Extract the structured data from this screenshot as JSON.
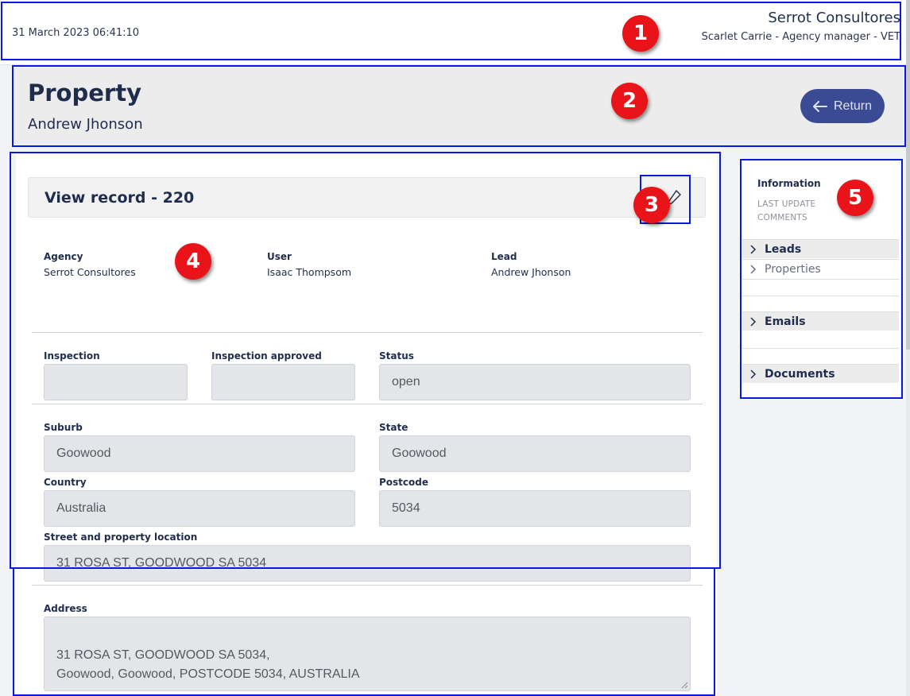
{
  "topbar": {
    "datetime": "31 March 2023 06:41:10",
    "company": "Serrot Consultores",
    "user_line": "Scarlet Carrie - Agency manager - VET"
  },
  "header": {
    "title": "Property",
    "subtitle": "Andrew Jhonson",
    "return_label": "Return"
  },
  "record": {
    "title": "View record - 220",
    "info": [
      {
        "label": "Agency",
        "value": "Serrot Consultores"
      },
      {
        "label": "User",
        "value": "Isaac Thompsom"
      },
      {
        "label": "Lead",
        "value": "Andrew Jhonson"
      }
    ],
    "fields": {
      "inspection": {
        "label": "Inspection",
        "value": ""
      },
      "inspection_approved": {
        "label": "Inspection approved",
        "value": ""
      },
      "status": {
        "label": "Status",
        "value": "open"
      },
      "suburb": {
        "label": "Suburb",
        "value": "Goowood"
      },
      "state": {
        "label": "State",
        "value": "Goowood"
      },
      "country": {
        "label": "Country",
        "value": "Australia"
      },
      "postcode": {
        "label": "Postcode",
        "value": "5034"
      },
      "street": {
        "label": "Street and property location",
        "value": "31 ROSA ST, GOODWOOD SA 5034"
      },
      "address": {
        "label": "Address",
        "value": "31 ROSA ST, GOODWOOD SA 5034,\nGoowood, Goowood, POSTCODE 5034, AUSTRALIA"
      }
    }
  },
  "sidebar": {
    "title": "Information",
    "meta": [
      "LAST UPDATE",
      "COMMENTS"
    ],
    "items": [
      {
        "label": "Leads"
      },
      {
        "label": "Properties"
      },
      {
        "label": "Emails"
      },
      {
        "label": "Documents"
      }
    ]
  },
  "annotations": [
    "1",
    "2",
    "3",
    "4",
    "5"
  ],
  "colors": {
    "accent": "#3a4b94",
    "annotation_box": "#0a1adc",
    "annotation_badge": "#e8141a"
  }
}
